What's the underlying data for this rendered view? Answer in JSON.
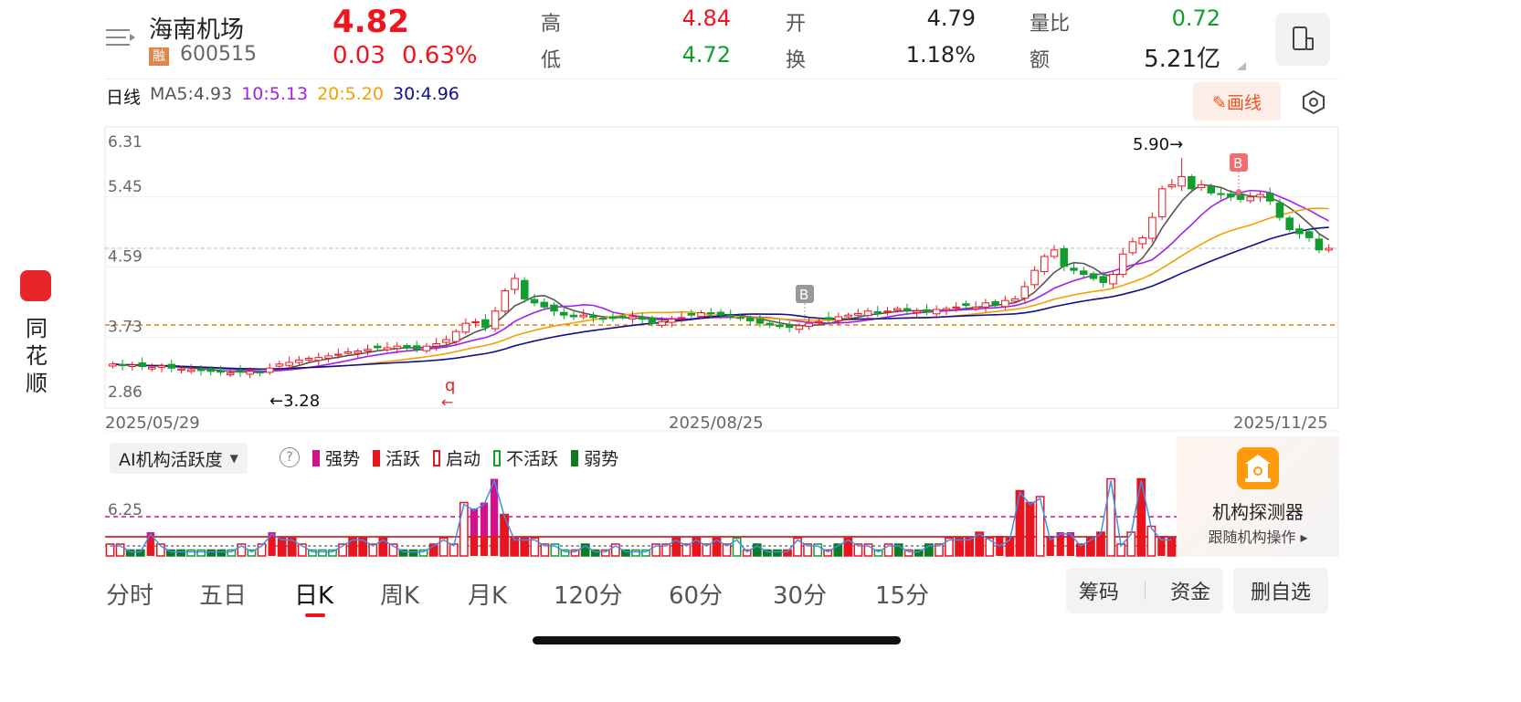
{
  "sidebar": {
    "app_name_chars": [
      "同",
      "花",
      "顺"
    ]
  },
  "header": {
    "stock_name": "海南机场",
    "margin_badge": "融",
    "code": "600515",
    "price": "4.82",
    "change": "0.03",
    "change_pct": "0.63%",
    "stats": [
      {
        "label": "高",
        "value": "4.84",
        "color": "red"
      },
      {
        "label": "低",
        "value": "4.72",
        "color": "green"
      },
      {
        "label": "开",
        "value": "4.79",
        "color": "dark"
      },
      {
        "label": "换",
        "value": "1.18%",
        "color": "dark"
      },
      {
        "label": "量比",
        "value": "0.72",
        "color": "green"
      },
      {
        "label": "额",
        "value": "5.21亿",
        "color": "dark"
      }
    ]
  },
  "ma_bar": {
    "period": "日线",
    "ma5": "MA5:4.93",
    "ma10": "10:5.13",
    "ma20": "20:5.20",
    "ma30": "30:4.96",
    "draw_button": "✎画线"
  },
  "colors": {
    "up": "#f0141e",
    "down": "#129e2e",
    "ma5": "#555555",
    "ma10": "#a020f0",
    "ma20": "#f5a000",
    "ma30": "#10108c",
    "strong": "#d4108c",
    "orange_line": "#f07800"
  },
  "chart_data": {
    "type": "candlestick",
    "y_ticks": [
      "6.31",
      "5.45",
      "4.59",
      "3.73",
      "2.86"
    ],
    "ylim": [
      2.86,
      6.31
    ],
    "x_ticks": [
      "2025/05/29",
      "2025/08/25",
      "2025/11/25"
    ],
    "annotations": {
      "high": "5.90→",
      "low": "←3.28",
      "buy_marker": "B",
      "q_marker": "q"
    },
    "close": [
      3.4,
      3.38,
      3.39,
      3.37,
      3.36,
      3.38,
      3.35,
      3.34,
      3.33,
      3.32,
      3.31,
      3.3,
      3.29,
      3.3,
      3.31,
      3.29,
      3.35,
      3.4,
      3.42,
      3.45,
      3.47,
      3.48,
      3.5,
      3.52,
      3.55,
      3.56,
      3.58,
      3.6,
      3.6,
      3.62,
      3.6,
      3.58,
      3.62,
      3.65,
      3.7,
      3.8,
      3.9,
      3.92,
      3.85,
      4.05,
      4.3,
      4.45,
      4.2,
      4.15,
      4.1,
      4.05,
      4.0,
      3.98,
      4.0,
      3.97,
      3.95,
      3.96,
      3.97,
      3.98,
      3.95,
      3.9,
      3.92,
      3.95,
      3.97,
      4.0,
      4.03,
      4.02,
      4.0,
      3.98,
      3.96,
      3.93,
      3.9,
      3.88,
      3.86,
      3.85,
      3.87,
      3.9,
      3.92,
      3.95,
      3.98,
      4.0,
      4.02,
      4.05,
      4.03,
      4.05,
      4.08,
      4.06,
      4.05,
      4.04,
      4.07,
      4.08,
      4.1,
      4.12,
      4.1,
      4.15,
      4.13,
      4.18,
      4.2,
      4.35,
      4.55,
      4.72,
      4.8,
      4.6,
      4.55,
      4.5,
      4.45,
      4.4,
      4.5,
      4.75,
      4.9,
      4.95,
      5.2,
      5.55,
      5.6,
      5.7,
      5.55,
      5.6,
      5.5,
      5.48,
      5.45,
      5.42,
      5.45,
      5.48,
      5.4,
      5.2,
      5.05,
      5.0,
      4.95,
      4.8,
      4.82
    ],
    "reference_lines": {
      "current": 4.82,
      "orange": 3.88
    }
  },
  "indicator": {
    "selector": "AI机构活跃度",
    "help": "?",
    "legend": [
      {
        "label": "强势",
        "kind": "strong"
      },
      {
        "label": "活跃",
        "kind": "active"
      },
      {
        "label": "启动",
        "kind": "start"
      },
      {
        "label": "不活跃",
        "kind": "inactive"
      },
      {
        "label": "弱势",
        "kind": "weak"
      }
    ],
    "level_label": "6.25",
    "types": "qqwwsqwwnnwwnqnqsaaqnnnqaaqaqwwnaqqqsssaaaqqnnqwwqqwnnqqaqaqaqnqwwwaqqnqwaqqnqwqwwqqaaaqsaaaqsssaaaqqqaqsaqs",
    "values": [
      2,
      2,
      1,
      1,
      4,
      2,
      1,
      1,
      1,
      1,
      1,
      1,
      1,
      2,
      1,
      2,
      4,
      3,
      3,
      2,
      1,
      1,
      1,
      2,
      3,
      3,
      2,
      3,
      2,
      1,
      1,
      1,
      2,
      3,
      2,
      9,
      8,
      9,
      13,
      7,
      3,
      3,
      3,
      2,
      2,
      1,
      1,
      2,
      1,
      1,
      2,
      1,
      1,
      1,
      2,
      2,
      3,
      2,
      3,
      2,
      3,
      2,
      3,
      1,
      2,
      1,
      1,
      1,
      3,
      2,
      2,
      1,
      2,
      3,
      2,
      2,
      1,
      2,
      2,
      1,
      1,
      2,
      2,
      3,
      3,
      3,
      4,
      3,
      2,
      3,
      11,
      9,
      10,
      3,
      4,
      4,
      2,
      3,
      4,
      13,
      2,
      4,
      13,
      5,
      3,
      3
    ]
  },
  "detector": {
    "title": "机构探测器",
    "subtitle": "跟随机构操作 ▸"
  },
  "tabs": [
    "分时",
    "五日",
    "日K",
    "周K",
    "月K",
    "120分",
    "60分",
    "30分",
    "15分"
  ],
  "active_tab": 2,
  "buttons": {
    "chips": "筹码",
    "funds": "资金",
    "remove": "删自选"
  }
}
